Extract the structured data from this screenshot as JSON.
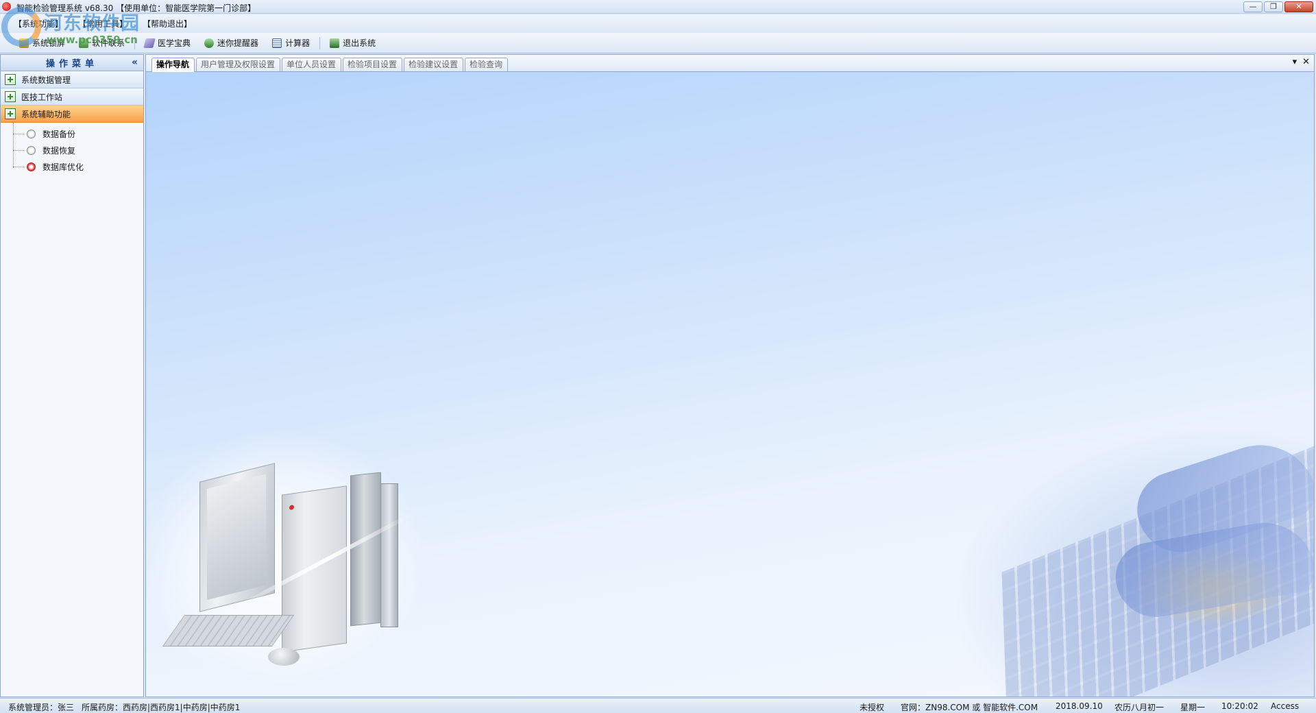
{
  "window": {
    "title": "智能检验管理系统 v68.30 【使用单位：智能医学院第一门诊部】",
    "controls": {
      "minimize": "—",
      "restore": "❐",
      "close": "✕"
    }
  },
  "watermark": {
    "text": "河东软件园",
    "url": "www.pc0359.cn"
  },
  "menubar": {
    "items": [
      {
        "label": "【系统功能】"
      },
      {
        "label": "【常用工具】"
      },
      {
        "label": "【帮助退出】"
      }
    ]
  },
  "toolbar": {
    "buttons": [
      {
        "label": "系统锁屏",
        "icon": "lock-icon"
      },
      {
        "label": "软件联系",
        "icon": "contact-icon"
      },
      {
        "label": "医学宝典",
        "icon": "book-icon"
      },
      {
        "label": "迷你提醒器",
        "icon": "reminder-icon"
      },
      {
        "label": "计算器",
        "icon": "calculator-icon"
      },
      {
        "label": "退出系统",
        "icon": "exit-icon"
      }
    ]
  },
  "sidebar": {
    "title": "操作菜单",
    "collapse": "«",
    "groups": [
      {
        "label": "系统数据管理",
        "active": false
      },
      {
        "label": "医技工作站",
        "active": false
      },
      {
        "label": "系统辅助功能",
        "active": true
      }
    ],
    "tree": [
      {
        "label": "数据备份"
      },
      {
        "label": "数据恢复"
      },
      {
        "label": "数据库优化"
      }
    ]
  },
  "main": {
    "tabs": [
      {
        "label": "操作导航",
        "active": true
      },
      {
        "label": "用户管理及权限设置",
        "active": false
      },
      {
        "label": "单位人员设置",
        "active": false
      },
      {
        "label": "检验项目设置",
        "active": false
      },
      {
        "label": "检验建议设置",
        "active": false
      },
      {
        "label": "检验查询",
        "active": false
      }
    ],
    "tab_menu": "▾",
    "tab_close": "✕"
  },
  "statusbar": {
    "operator": "系统管理员：张三",
    "pharmacy": "所属药房：西药房|西药房1|中药房|中药房1",
    "license": "未授权",
    "website": "官网：ZN98.COM 或 智能软件.COM",
    "date": "2018.09.10",
    "lunar": "农历八月初一",
    "weekday": "星期一",
    "time": "10:20:02",
    "db": "Access"
  },
  "colors": {
    "accent": "#15428b",
    "active_group": "#f6a24a",
    "content_bg": "#cfe3fb"
  }
}
